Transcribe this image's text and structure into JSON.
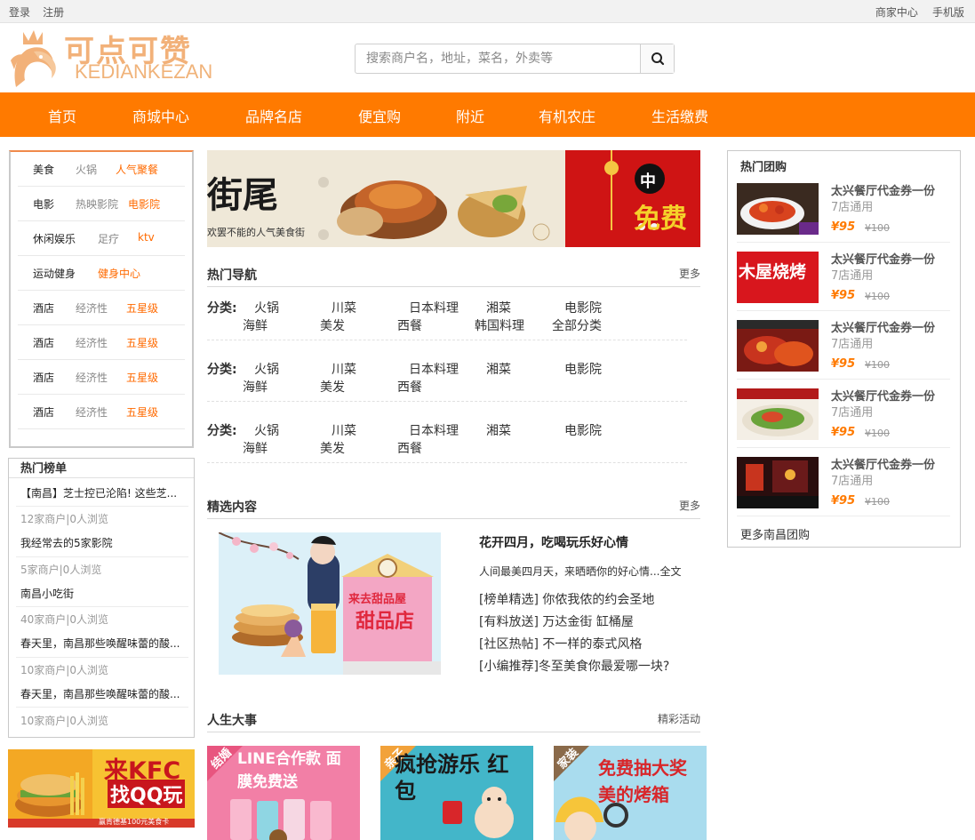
{
  "topbar": {
    "login": "登录",
    "register": "注册",
    "merchant": "商家中心",
    "mobile": "手机版"
  },
  "logo": {
    "cn": "可点可赞",
    "en": "KEDIANKEZAN"
  },
  "search": {
    "placeholder": "搜索商户名，地址，菜名，外卖等"
  },
  "nav": [
    "首页",
    "商城中心",
    "品牌名店",
    "便宜购",
    "附近",
    "有机农庄",
    "生活缴费"
  ],
  "categories": [
    {
      "main": "美食",
      "sub1": "火锅",
      "sub2": "人气聚餐"
    },
    {
      "main": "电影",
      "sub1": "热映影院",
      "sub2": "电影院"
    },
    {
      "main": "休闲娱乐",
      "sub1": "足疗",
      "sub2": "ktv"
    },
    {
      "main": "运动健身",
      "sub1": "",
      "sub2": "健身中心"
    },
    {
      "main": "酒店",
      "sub1": "经济性",
      "sub2": "五星级"
    },
    {
      "main": "酒店",
      "sub1": "经济性",
      "sub2": "五星级"
    },
    {
      "main": "酒店",
      "sub1": "经济性",
      "sub2": "五星级"
    },
    {
      "main": "酒店",
      "sub1": "经济性",
      "sub2": "五星级"
    }
  ],
  "hotlist": {
    "title": "热门榜单",
    "items": [
      {
        "title": "【南昌】芝士控已沦陷! 这些芝...",
        "meta": "12家商户|0人浏览"
      },
      {
        "title": "我经常去的5家影院",
        "meta": "5家商户|0人浏览"
      },
      {
        "title": "南昌小吃街",
        "meta": "40家商户|0人浏览"
      },
      {
        "title": "春天里，南昌那些唤醒味蕾的酸...",
        "meta": "10家商户|0人浏览"
      },
      {
        "title": "春天里，南昌那些唤醒味蕾的酸...",
        "meta": "10家商户|0人浏览"
      }
    ]
  },
  "kfc": {
    "line1": "来KFC",
    "line2": "找QQ玩",
    "line3": "赢肯德基100元美食卡"
  },
  "banner": {
    "left_text": "街尾",
    "left_sub": "欢罢不能的人气美食街",
    "right_char": "中",
    "right_text": "免费"
  },
  "hotnav": {
    "title": "热门导航",
    "more": "更多",
    "label": "分类:",
    "rows": [
      [
        "火锅",
        "川菜",
        "日本料理",
        "湘菜",
        "电影院",
        "海鲜",
        "美发",
        "西餐",
        "韩国料理",
        "全部分类"
      ],
      [
        "火锅",
        "川菜",
        "日本料理",
        "湘菜",
        "电影院",
        "海鲜",
        "美发",
        "西餐"
      ],
      [
        "火锅",
        "川菜",
        "日本料理",
        "湘菜",
        "电影院",
        "海鲜",
        "美发",
        "西餐"
      ]
    ]
  },
  "selected": {
    "title": "精选内容",
    "more": "更多",
    "headline": "花开四月，吃喝玩乐好心情",
    "desc": "人间最美四月天，来晒晒你的好心情...全文",
    "links": [
      "[榜单精选] 你侬我侬的约会圣地",
      "[有料放送] 万达金街 缸桶屋",
      "[社区热帖] 不一样的泰式风格",
      "[小编推荐]冬至美食你最爱哪一块?"
    ],
    "img_sign": "来去甜品屋",
    "img_sign2": "甜品店"
  },
  "events": {
    "title": "人生大事",
    "more": "精彩活动",
    "cards": [
      {
        "tag": "结婚",
        "text": "LINE合作款 面膜免费送",
        "bg": "#f27fa6"
      },
      {
        "tag": "亲子",
        "text": "疯抢游乐 红包",
        "bg": "#43b6c9"
      },
      {
        "tag": "家装",
        "text": "免费抽大奖 美的烤箱",
        "bg": "#a9dcee"
      }
    ]
  },
  "group": {
    "title": "热门团购",
    "items": [
      {
        "name": "太兴餐厅代金券一份",
        "sub": "7店通用",
        "price": "¥95",
        "old": "¥100",
        "img_text": ""
      },
      {
        "name": "太兴餐厅代金券一份",
        "sub": "7店通用",
        "price": "¥95",
        "old": "¥100",
        "img_text": "木屋烧烤"
      },
      {
        "name": "太兴餐厅代金券一份",
        "sub": "7店通用",
        "price": "¥95",
        "old": "¥100",
        "img_text": ""
      },
      {
        "name": "太兴餐厅代金券一份",
        "sub": "7店通用",
        "price": "¥95",
        "old": "¥100",
        "img_text": ""
      },
      {
        "name": "太兴餐厅代金券一份",
        "sub": "7店通用",
        "price": "¥95",
        "old": "¥100",
        "img_text": ""
      }
    ],
    "more": "更多南昌团购"
  },
  "colors": {
    "brand": "#ff7a00",
    "accent_text": "#ff6a00",
    "logo": "#f2b179"
  }
}
